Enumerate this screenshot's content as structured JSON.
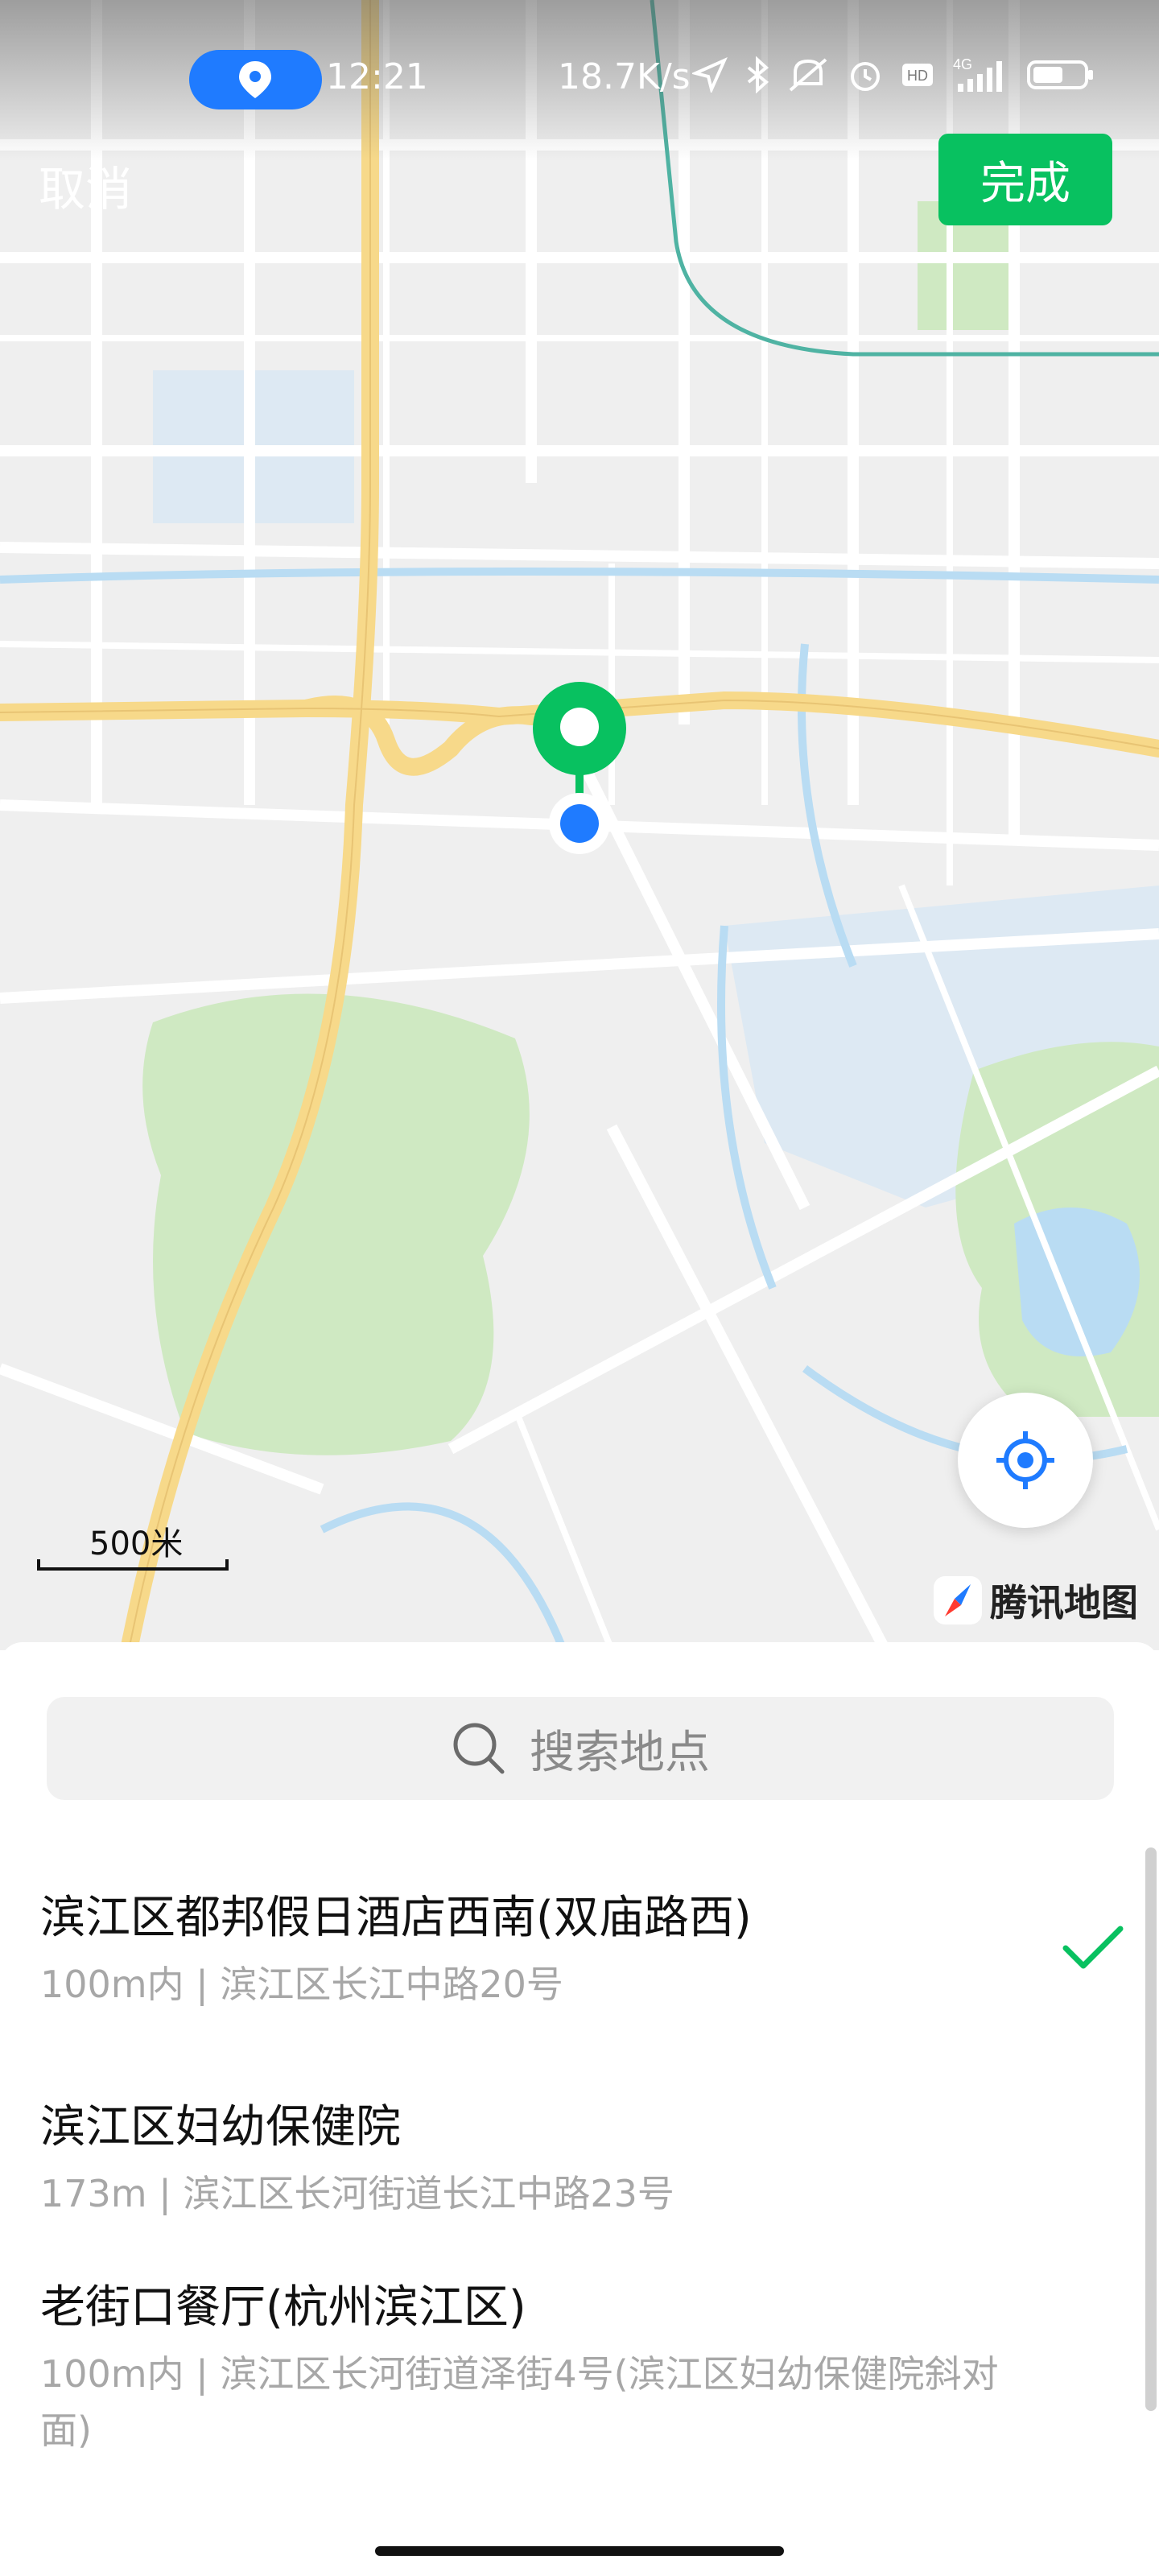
{
  "status_bar": {
    "time": "12:21",
    "network_speed": "18.7K/s",
    "network_type": "4G",
    "hd_badge": "HD",
    "icons": [
      "location-pill-icon",
      "navigation-arrow-icon",
      "bluetooth-icon",
      "mute-icon",
      "alarm-icon",
      "hd-icon",
      "signal-icon",
      "battery-icon"
    ]
  },
  "header": {
    "cancel_label": "取消",
    "done_label": "完成"
  },
  "map": {
    "scale_label": "500米",
    "provider_label": "腾讯地图",
    "colors": {
      "accent": "#08c160",
      "highway": "#f7d98a",
      "water": "#b9dcf3",
      "park": "#cfe9c2",
      "location_blue": "#1f7bff"
    }
  },
  "search": {
    "placeholder": "搜索地点"
  },
  "results": [
    {
      "title": "滨江区都邦假日酒店西南(双庙路西)",
      "subtitle": "100m内 | 滨江区长江中路20号",
      "selected": true
    },
    {
      "title": "滨江区妇幼保健院",
      "subtitle": "173m | 滨江区长河街道长江中路23号",
      "selected": false
    },
    {
      "title": "老街口餐厅(杭州滨江区)",
      "subtitle": "100m内 | 滨江区长河街道泽街4号(滨江区妇幼保健院斜对面)",
      "selected": false
    }
  ]
}
